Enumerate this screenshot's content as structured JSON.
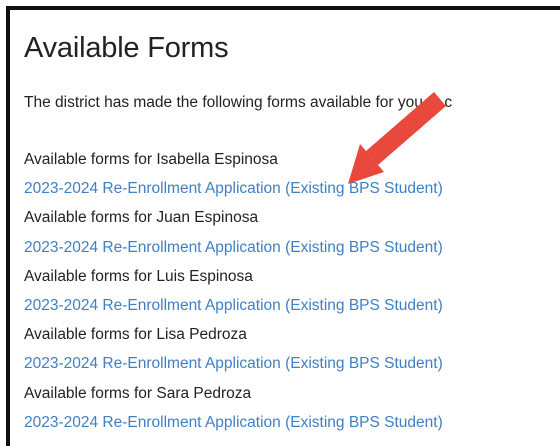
{
  "page": {
    "title": "Available Forms",
    "intro": "The district has made the following forms available for you to c"
  },
  "students": [
    {
      "label": "Available forms for Isabella Espinosa",
      "form_link": "2023-2024 Re-Enrollment Application (Existing BPS Student)"
    },
    {
      "label": "Available forms for Juan Espinosa",
      "form_link": "2023-2024 Re-Enrollment Application (Existing BPS Student)"
    },
    {
      "label": "Available forms for Luis Espinosa",
      "form_link": "2023-2024 Re-Enrollment Application (Existing BPS Student)"
    },
    {
      "label": "Available forms for Lisa Pedroza",
      "form_link": "2023-2024 Re-Enrollment Application (Existing BPS Student)"
    },
    {
      "label": "Available forms for Sara Pedroza",
      "form_link": "2023-2024 Re-Enrollment Application (Existing BPS Student)"
    }
  ],
  "colors": {
    "link": "#3f7fc4",
    "text": "#222222",
    "annotation_arrow": "#e8493c",
    "border": "#111111"
  },
  "annotation": {
    "icon": "red-arrow-icon"
  }
}
